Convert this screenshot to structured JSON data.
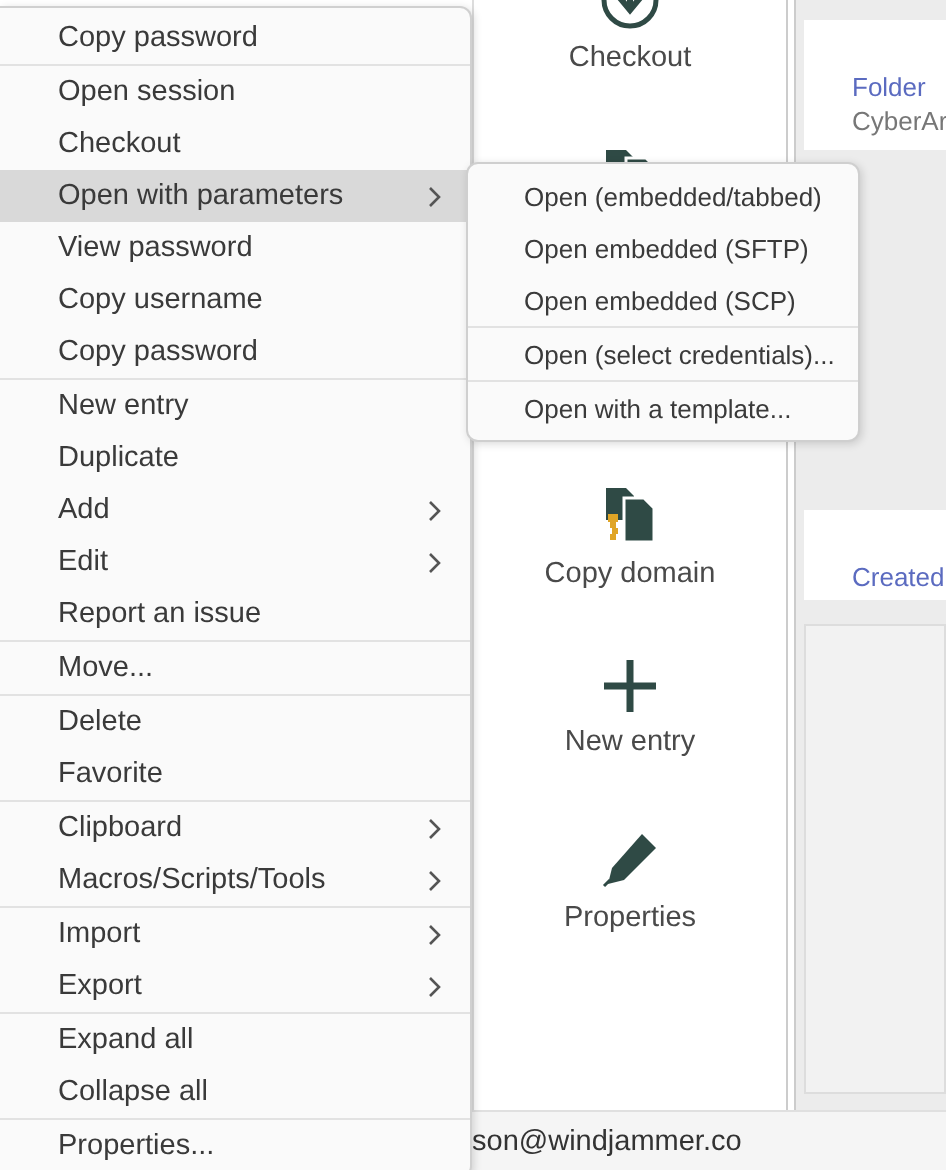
{
  "menu": {
    "groups": [
      [
        {
          "label": "Copy password",
          "submenu": false,
          "selected": false
        }
      ],
      [
        {
          "label": "Open session",
          "submenu": false,
          "selected": false
        },
        {
          "label": "Checkout",
          "submenu": false,
          "selected": false
        },
        {
          "label": "Open with parameters",
          "submenu": true,
          "selected": true
        },
        {
          "label": "View password",
          "submenu": false,
          "selected": false
        },
        {
          "label": "Copy username",
          "submenu": false,
          "selected": false
        },
        {
          "label": "Copy password",
          "submenu": false,
          "selected": false
        }
      ],
      [
        {
          "label": "New entry",
          "submenu": false,
          "selected": false
        },
        {
          "label": "Duplicate",
          "submenu": false,
          "selected": false
        },
        {
          "label": "Add",
          "submenu": true,
          "selected": false
        },
        {
          "label": "Edit",
          "submenu": true,
          "selected": false
        },
        {
          "label": "Report an issue",
          "submenu": false,
          "selected": false
        }
      ],
      [
        {
          "label": "Move...",
          "submenu": false,
          "selected": false
        }
      ],
      [
        {
          "label": "Delete",
          "submenu": false,
          "selected": false
        },
        {
          "label": "Favorite",
          "submenu": false,
          "selected": false
        }
      ],
      [
        {
          "label": "Clipboard",
          "submenu": true,
          "selected": false
        },
        {
          "label": "Macros/Scripts/Tools",
          "submenu": true,
          "selected": false
        }
      ],
      [
        {
          "label": "Import",
          "submenu": true,
          "selected": false
        },
        {
          "label": "Export",
          "submenu": true,
          "selected": false
        }
      ],
      [
        {
          "label": "Expand all",
          "submenu": false,
          "selected": false
        },
        {
          "label": "Collapse all",
          "submenu": false,
          "selected": false
        }
      ],
      [
        {
          "label": "Properties...",
          "submenu": false,
          "selected": false
        }
      ]
    ]
  },
  "submenu": {
    "groups": [
      [
        {
          "label": "Open (embedded/tabbed)",
          "selected": false
        },
        {
          "label": "Open embedded (SFTP)",
          "selected": false
        },
        {
          "label": "Open embedded (SCP)",
          "selected": false
        }
      ],
      [
        {
          "label": "Open (select credentials)...",
          "selected": false
        }
      ],
      [
        {
          "label": "Open with a template...",
          "selected": false
        }
      ]
    ]
  },
  "toolbar": {
    "items": [
      {
        "kind": "checkout",
        "label": "Checkout"
      },
      {
        "kind": "copy"
      },
      {
        "kind": "copy-domain",
        "label": "Copy domain"
      },
      {
        "kind": "add",
        "label": "New entry"
      },
      {
        "kind": "edit",
        "label": "Properties"
      }
    ]
  },
  "details": {
    "cards": [
      {
        "title": "Folder",
        "value": "CyberAr"
      },
      {
        "title": "Created"
      }
    ]
  },
  "status_bar": {
    "text": "son@windjammer.co"
  }
}
